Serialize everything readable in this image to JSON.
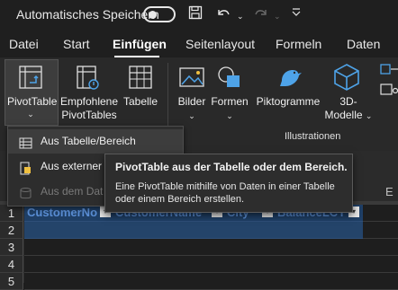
{
  "titlebar": {
    "autosave_label": "Automatisches Speichern",
    "save_icon": "save-icon",
    "undo_icon": "undo-icon",
    "redo_icon": "redo-icon",
    "more_icon": "chevron-down-icon"
  },
  "tabs": [
    {
      "label": "Datei"
    },
    {
      "label": "Start"
    },
    {
      "label": "Einfügen",
      "active": true
    },
    {
      "label": "Seitenlayout"
    },
    {
      "label": "Formeln"
    },
    {
      "label": "Daten"
    }
  ],
  "ribbon": {
    "pivot_label": "PivotTable",
    "recommended_line1": "Empfohlene",
    "recommended_line2": "PivotTables",
    "table_label": "Tabelle",
    "images_label": "Bilder",
    "shapes_label": "Formen",
    "pictograms_label": "Piktogramme",
    "models_line1": "3D-",
    "models_line2": "Modelle",
    "group_illustrations": "Illustrationen",
    "dropdown_glyph": "⌄"
  },
  "menu": {
    "items": [
      {
        "label": "Aus Tabelle/Bereich",
        "state": "hover"
      },
      {
        "label": "Aus externer D",
        "state": "normal"
      },
      {
        "label": "Aus dem Dat",
        "state": "disabled"
      }
    ]
  },
  "tooltip": {
    "title": "PivotTable aus der Tabelle oder dem Bereich.",
    "body": "Eine PivotTable mithilfe von Daten in einer Tabelle oder einem Bereich erstellen."
  },
  "sheet": {
    "row_numbers": [
      "1",
      "2",
      "3",
      "4",
      "5"
    ],
    "headers": [
      "CustomerNo",
      "CustomerName",
      "City",
      "BalanceLCY"
    ],
    "column_letter": "E"
  },
  "colors": {
    "accent": "#217346",
    "table_header_text": "#5b8fd6",
    "table_row_bg": "#24446a"
  }
}
